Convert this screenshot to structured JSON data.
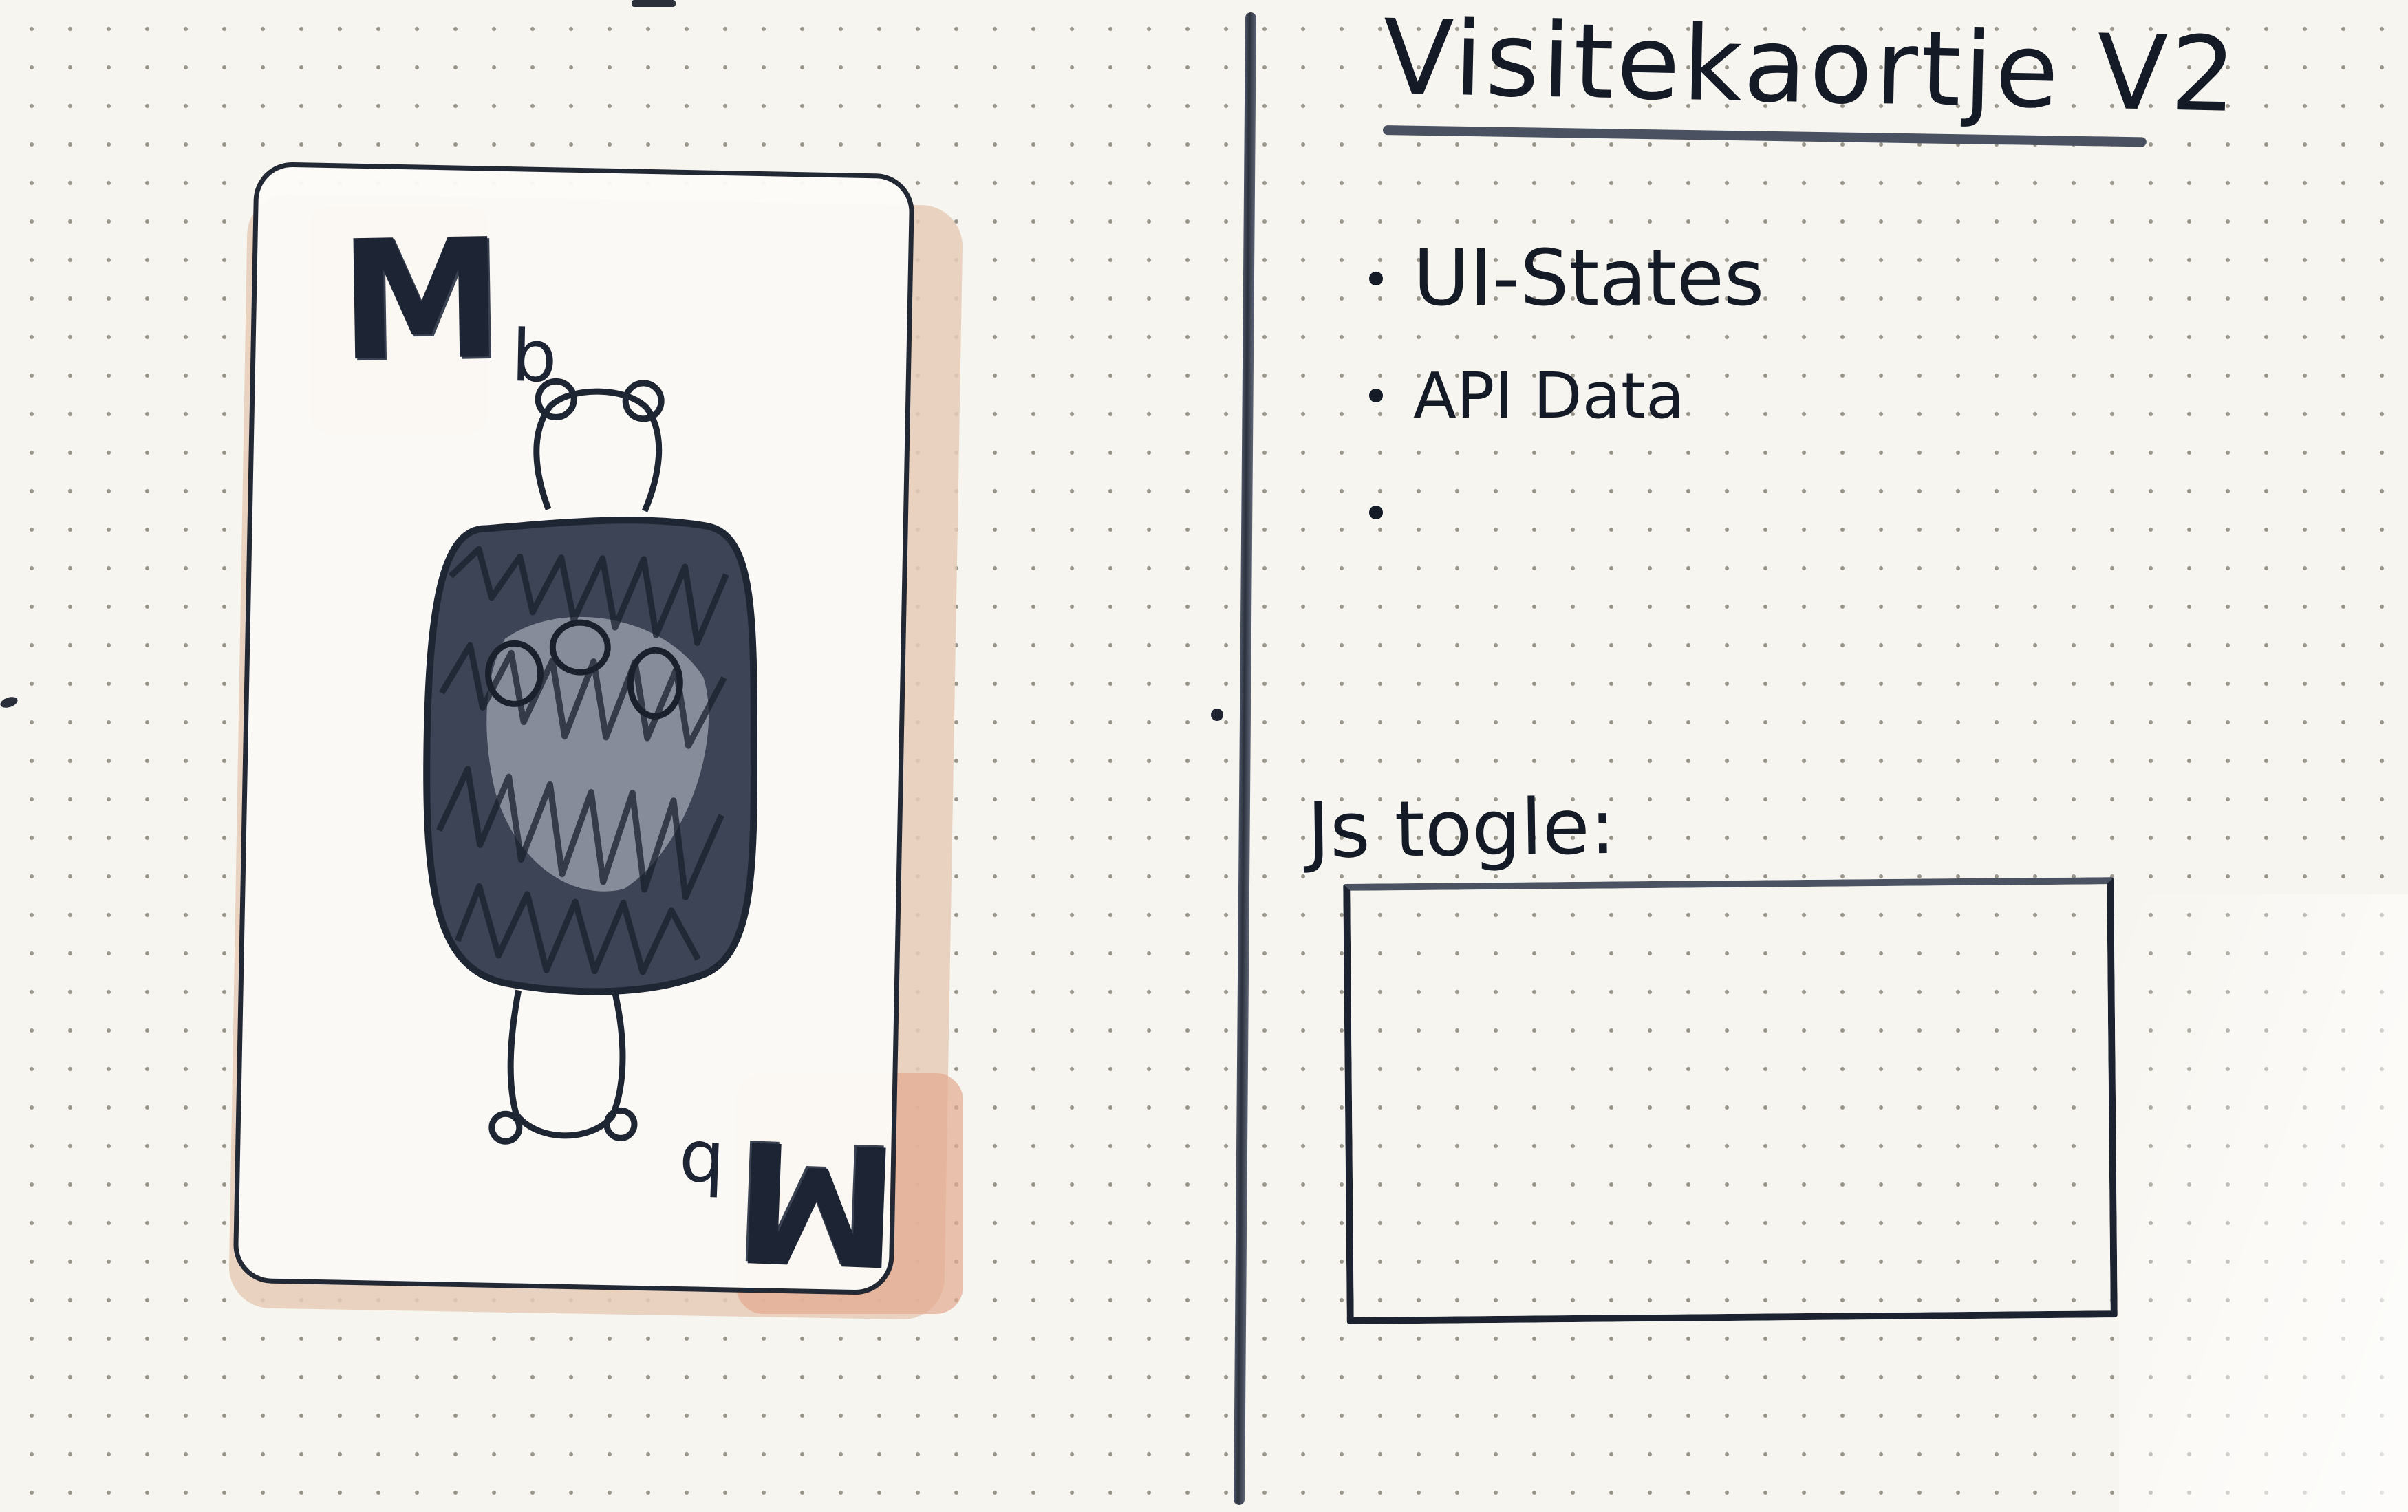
{
  "card": {
    "top_index_letter": "M",
    "top_index_sub": "b",
    "bottom_index_letter": "M",
    "bottom_index_sub": "b"
  },
  "notes": {
    "title": "Visitekaortje V2",
    "items": [
      {
        "label": "UI-States"
      },
      {
        "label": "API Data"
      },
      {
        "label": ""
      }
    ],
    "toggle_label": "Js togle:"
  },
  "colors": {
    "paper": "#f7f5ef",
    "ink": "#1c2230",
    "stain": "#e3a98f"
  }
}
